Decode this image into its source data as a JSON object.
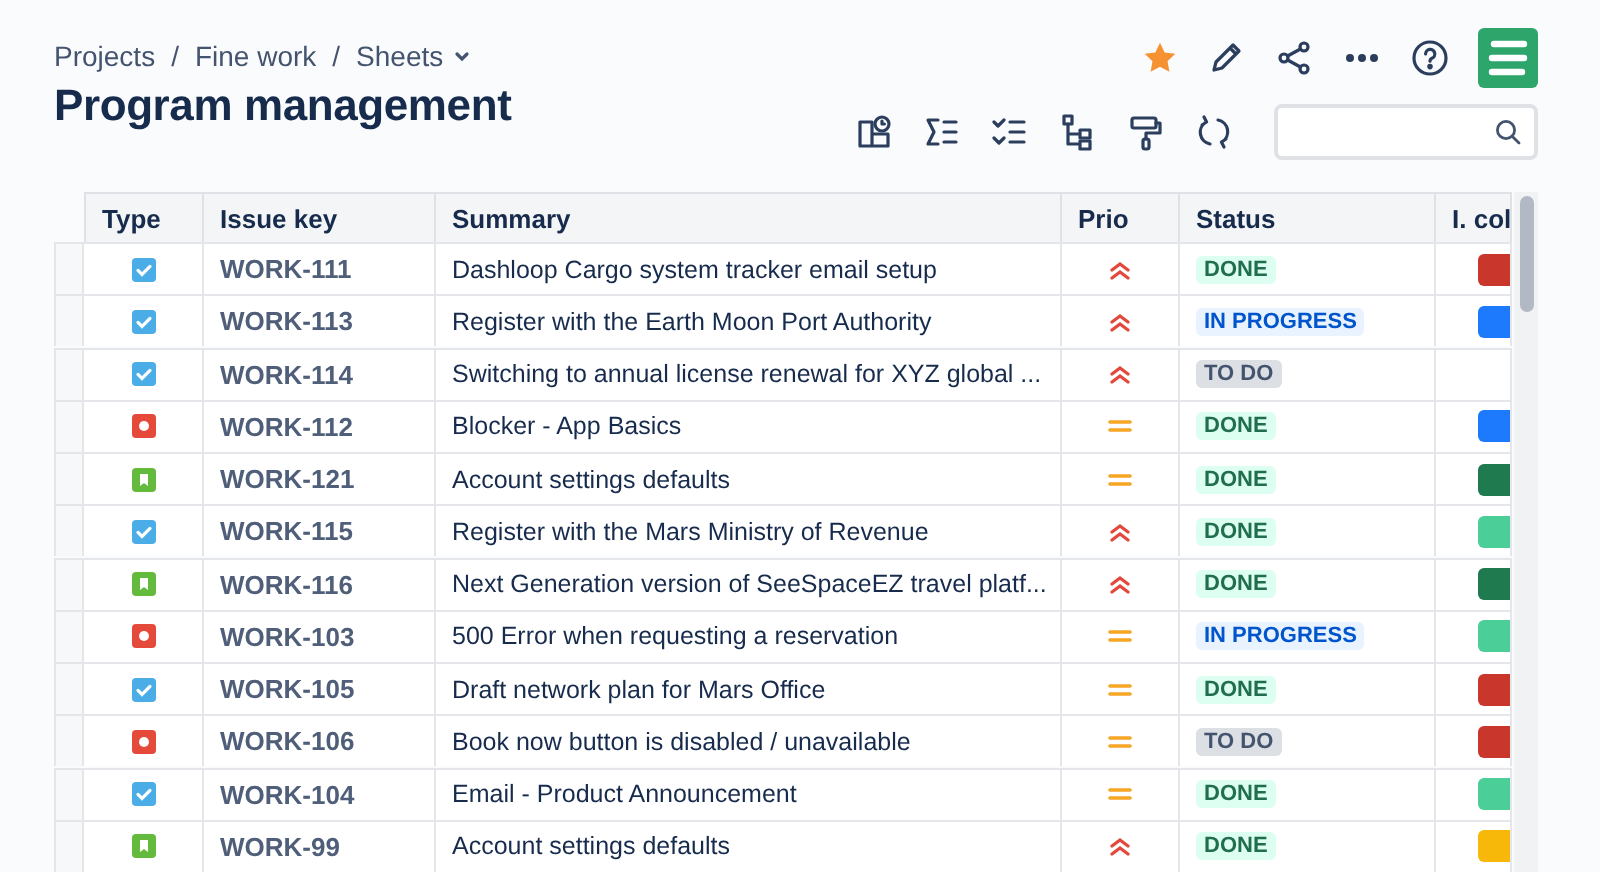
{
  "breadcrumb": [
    {
      "label": "Projects"
    },
    {
      "separator": "/",
      "label": "Fine work"
    },
    {
      "separator": "/",
      "label": "Sheets",
      "dropdown": true
    }
  ],
  "title": "Program management",
  "header_actions": {
    "starred": true
  },
  "table": {
    "columns": [
      "Type",
      "Issue key",
      "Summary",
      "Prio",
      "Status",
      "I. col"
    ],
    "rows": [
      {
        "type": {
          "kind": "task"
        },
        "key": "WORK-111",
        "summary": "Dashloop Cargo system tracker email setup",
        "prio": {
          "kind": "high"
        },
        "status": {
          "kind": "done",
          "label": "DONE"
        },
        "color": "#c9372c"
      },
      {
        "type": {
          "kind": "task"
        },
        "key": "WORK-113",
        "summary": "Register with the Earth Moon Port Authority",
        "prio": {
          "kind": "high"
        },
        "status": {
          "kind": "inprogress",
          "label": "IN PROGRESS"
        },
        "color": "#1d7afc"
      },
      {
        "type": {
          "kind": "task"
        },
        "key": "WORK-114",
        "summary": "Switching to annual license renewal for XYZ global ...",
        "prio": {
          "kind": "high"
        },
        "status": {
          "kind": "todo",
          "label": "TO DO"
        }
      },
      {
        "type": {
          "kind": "bug"
        },
        "key": "WORK-112",
        "summary": "Blocker - App Basics",
        "prio": {
          "kind": "medium"
        },
        "status": {
          "kind": "done",
          "label": "DONE"
        },
        "color": "#1d7afc"
      },
      {
        "type": {
          "kind": "story"
        },
        "key": "WORK-121",
        "summary": "Account settings defaults",
        "prio": {
          "kind": "medium"
        },
        "status": {
          "kind": "done",
          "label": "DONE"
        },
        "color": "#1f7a4f"
      },
      {
        "type": {
          "kind": "task"
        },
        "key": "WORK-115",
        "summary": "Register with the Mars Ministry of Revenue",
        "prio": {
          "kind": "high"
        },
        "status": {
          "kind": "done",
          "label": "DONE"
        },
        "color": "#4bce97"
      },
      {
        "type": {
          "kind": "story"
        },
        "key": "WORK-116",
        "summary": "Next Generation version of SeeSpaceEZ travel platf...",
        "prio": {
          "kind": "high"
        },
        "status": {
          "kind": "done",
          "label": "DONE"
        },
        "color": "#1f7a4f"
      },
      {
        "type": {
          "kind": "bug"
        },
        "key": "WORK-103",
        "summary": "500 Error when requesting a reservation",
        "prio": {
          "kind": "medium"
        },
        "status": {
          "kind": "inprogress",
          "label": "IN PROGRESS"
        },
        "color": "#4bce97"
      },
      {
        "type": {
          "kind": "task"
        },
        "key": "WORK-105",
        "summary": "Draft network plan for Mars Office",
        "prio": {
          "kind": "medium"
        },
        "status": {
          "kind": "done",
          "label": "DONE"
        },
        "color": "#c9372c"
      },
      {
        "type": {
          "kind": "bug"
        },
        "key": "WORK-106",
        "summary": "Book now button is disabled / unavailable",
        "prio": {
          "kind": "medium"
        },
        "status": {
          "kind": "todo",
          "label": "TO DO"
        },
        "color": "#c9372c"
      },
      {
        "type": {
          "kind": "task"
        },
        "key": "WORK-104",
        "summary": "Email - Product Announcement",
        "prio": {
          "kind": "medium"
        },
        "status": {
          "kind": "done",
          "label": "DONE"
        },
        "color": "#4bce97"
      },
      {
        "type": {
          "kind": "story"
        },
        "key": "WORK-99",
        "summary": "Account settings defaults",
        "prio": {
          "kind": "high"
        },
        "status": {
          "kind": "done",
          "label": "DONE"
        },
        "color": "#f8b80a"
      }
    ]
  }
}
